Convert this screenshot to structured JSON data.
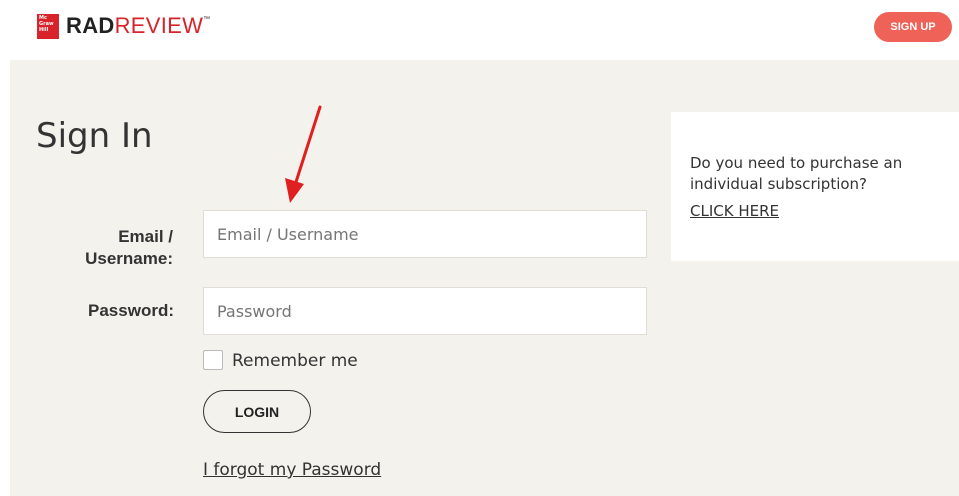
{
  "header": {
    "logo": {
      "brand_box": "Mc Graw Hill",
      "rad": "RAD",
      "review": "REVIEW",
      "tm": "™"
    },
    "signup_label": "SIGN UP"
  },
  "signin": {
    "title": "Sign In",
    "email_label": "Email / Username:",
    "email_placeholder": "Email / Username",
    "password_label": "Password:",
    "password_placeholder": "Password",
    "remember_label": "Remember me",
    "login_label": "LOGIN",
    "forgot_label": "I forgot my Password"
  },
  "side": {
    "text": "Do you need to purchase an individual subscription?",
    "link": "CLICK HERE"
  },
  "colors": {
    "accent": "#ee6257",
    "brand_red": "#d8232a",
    "panel_bg": "#f4f2ec"
  },
  "annotation": {
    "type": "red-arrow",
    "color": "#e02020"
  }
}
